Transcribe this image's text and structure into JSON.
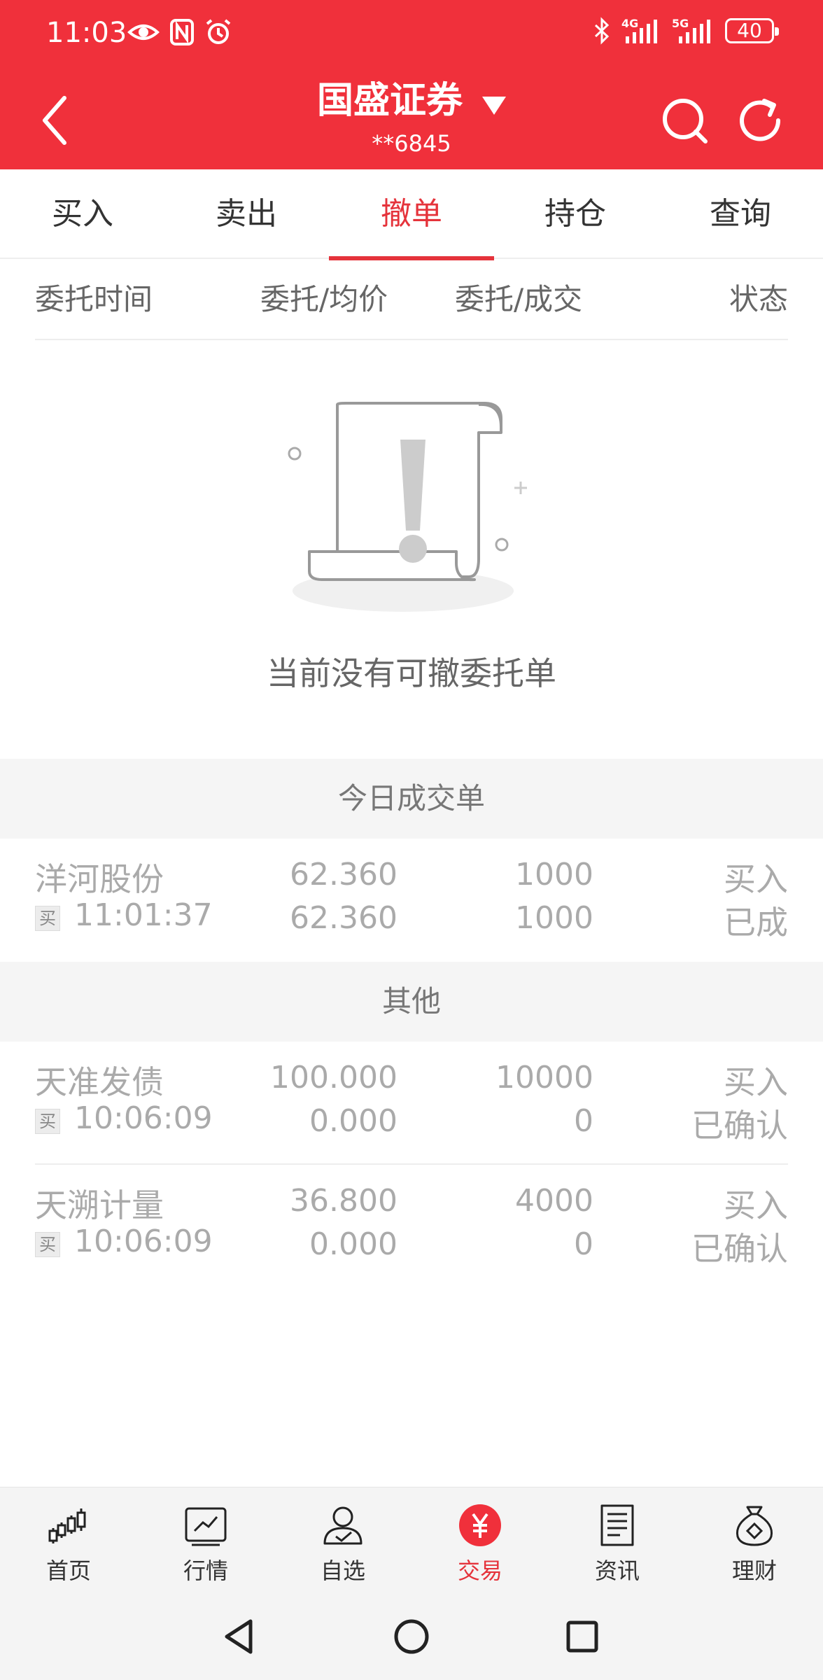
{
  "status_bar": {
    "time": "11:03",
    "network_1": "4G",
    "network_2": "5G",
    "battery": "40"
  },
  "header": {
    "title": "国盛证券",
    "account": "**6845",
    "accent_color": "#f0303b"
  },
  "tabs": [
    {
      "label": "买入"
    },
    {
      "label": "卖出"
    },
    {
      "label": "撤单",
      "active": true
    },
    {
      "label": "持仓"
    },
    {
      "label": "查询"
    }
  ],
  "columns": {
    "time": "委托时间",
    "price": "委托/均价",
    "quantity": "委托/成交",
    "status": "状态"
  },
  "empty_state": {
    "message": "当前没有可撤委托单",
    "icon": "exclamation-scroll-icon"
  },
  "sections": {
    "today": "今日成交单",
    "other": "其他"
  },
  "today_trades": [
    {
      "name": "洋河股份",
      "badge": "买",
      "time": "11:01:37",
      "price_order": "62.360",
      "price_avg": "62.360",
      "qty_order": "1000",
      "qty_filled": "1000",
      "direction": "买入",
      "status": "已成"
    }
  ],
  "other_trades": [
    {
      "name": "天准发债",
      "badge": "买",
      "time": "10:06:09",
      "price_order": "100.000",
      "price_avg": "0.000",
      "qty_order": "10000",
      "qty_filled": "0",
      "direction": "买入",
      "status": "已确认"
    },
    {
      "name": "天溯计量",
      "badge": "买",
      "time": "10:06:09",
      "price_order": "36.800",
      "price_avg": "0.000",
      "qty_order": "4000",
      "qty_filled": "0",
      "direction": "买入",
      "status": "已确认"
    }
  ],
  "bottom_nav": [
    {
      "label": "首页",
      "icon": "candlestick-icon"
    },
    {
      "label": "行情",
      "icon": "chart-line-icon"
    },
    {
      "label": "自选",
      "icon": "user-check-icon"
    },
    {
      "label": "交易",
      "icon": "yen-circle-icon",
      "active": true
    },
    {
      "label": "资讯",
      "icon": "document-icon"
    },
    {
      "label": "理财",
      "icon": "money-bag-icon"
    }
  ]
}
